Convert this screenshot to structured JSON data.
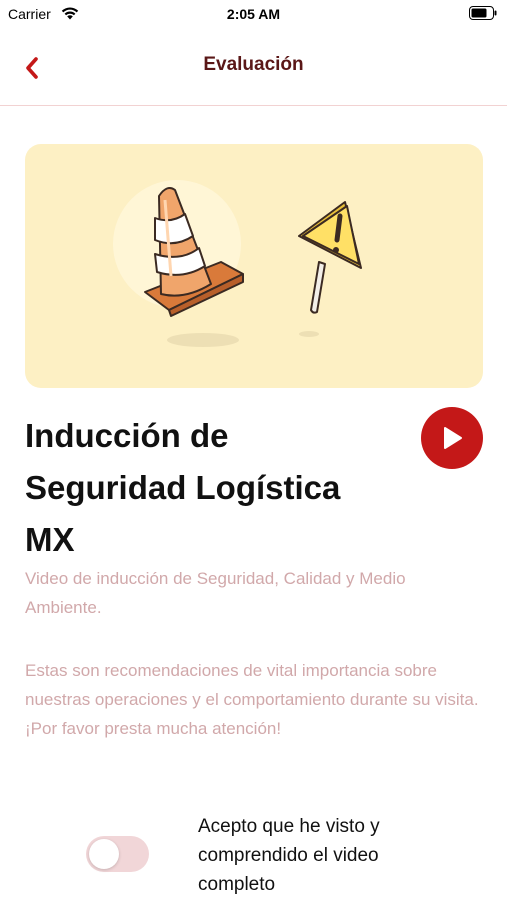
{
  "status_bar": {
    "carrier": "Carrier",
    "time": "2:05 AM"
  },
  "nav": {
    "title": "Evaluación",
    "back_icon": "chevron-left-icon",
    "accent_color": "#c41818"
  },
  "hero": {
    "illustration": "traffic-cone-and-warning-sign",
    "background_color": "#fdf0c4"
  },
  "course": {
    "title_line1": "Inducción de",
    "title_line2": "Seguridad Logística",
    "title_line3": "MX",
    "play_icon": "play-icon",
    "subtitle": "Video de inducción de Seguridad, Calidad y Medio Ambiente.",
    "description": "Estas son recomendaciones de vital importancia sobre nuestras operaciones y el comportamiento durante su visita. ¡Por favor presta mucha atención!"
  },
  "consent": {
    "label": "Acepto que he visto y comprendido el video completo",
    "checked": false
  }
}
